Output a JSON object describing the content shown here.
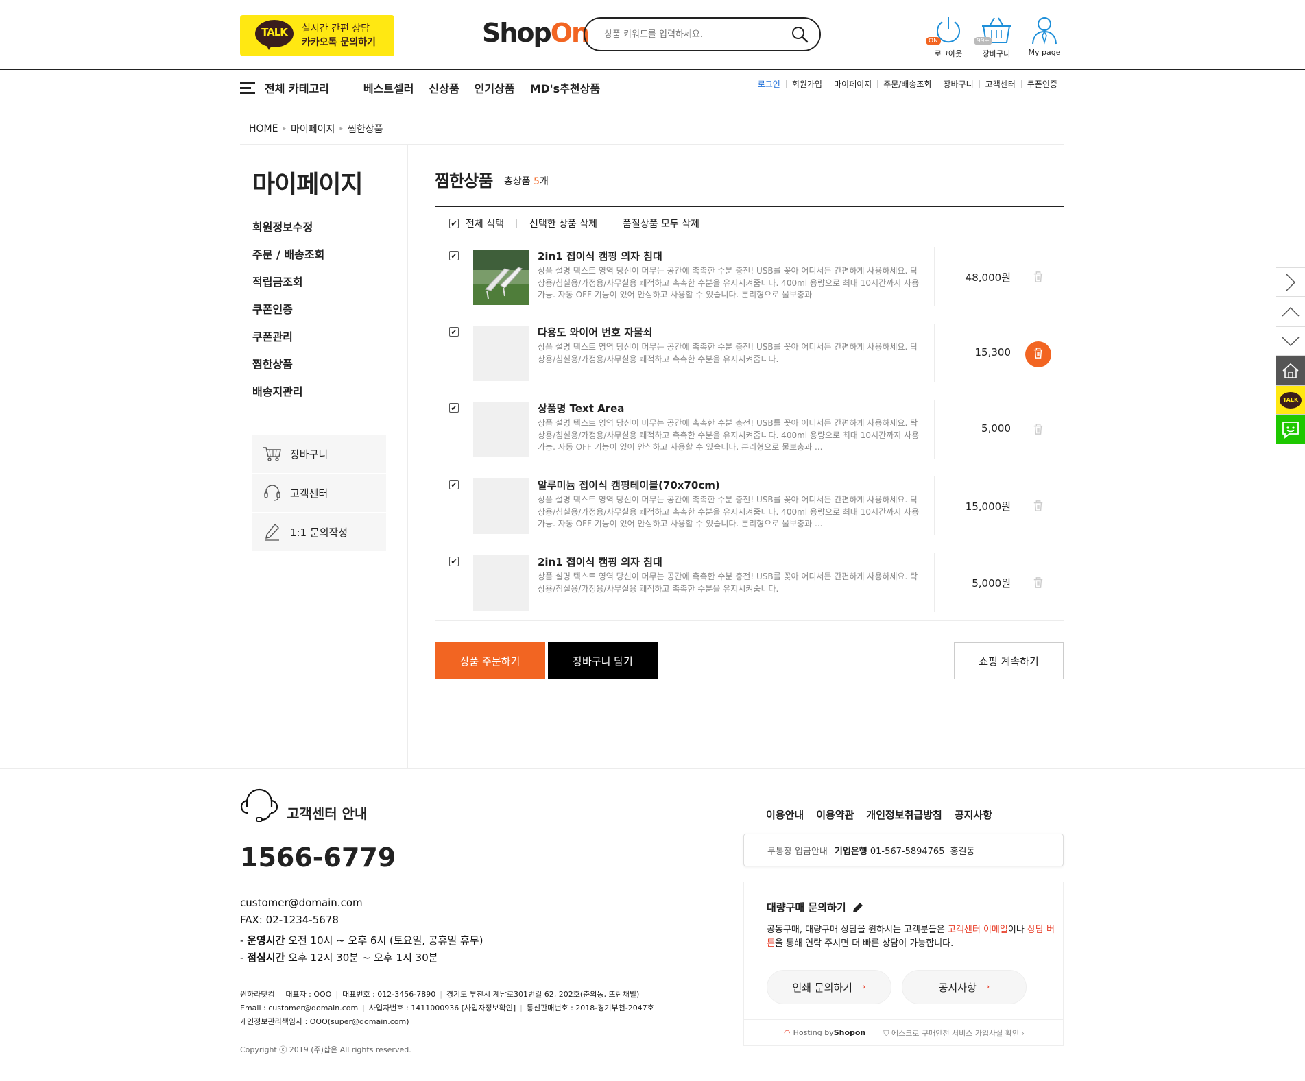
{
  "header": {
    "kakao": {
      "line1": "실시간 간편 상담",
      "line2": "카카오톡 문의하기",
      "icon_text": "TALK"
    },
    "logo": {
      "part1": "Shop",
      "part2": "On"
    },
    "search": {
      "placeholder": "상품 키워드를 입력하세요."
    },
    "icons": [
      {
        "name": "logout",
        "label": "로그아웃",
        "badge": "ON"
      },
      {
        "name": "cart",
        "label": "장바구니",
        "badge": "99+"
      },
      {
        "name": "mypage",
        "label": "My page"
      }
    ]
  },
  "nav": {
    "all_category": "전체 카테고리",
    "items": [
      "베스트셀러",
      "신상품",
      "인기상품",
      "MD's추천상품"
    ],
    "util": [
      "로그인",
      "회원가입",
      "마이페이지",
      "주문/배송조회",
      "장바구니",
      "고객센터",
      "쿠폰인증"
    ]
  },
  "breadcrumb": [
    "HOME",
    "마이페이지",
    "찜한상품"
  ],
  "sidebar": {
    "title": "마이페이지",
    "menu": [
      "회원정보수정",
      "주문 / 배송조회",
      "적립금조회",
      "쿠폰인증",
      "쿠폰관리",
      "찜한상품",
      "배송지관리"
    ],
    "boxes": [
      {
        "icon": "cart-icon",
        "label": "장바구니"
      },
      {
        "icon": "headset-icon",
        "label": "고객센터"
      },
      {
        "icon": "pencil-icon",
        "label": "1:1 문의작성"
      }
    ]
  },
  "content": {
    "title": "찜한상품",
    "total_prefix": "총상품",
    "total_count": "5",
    "total_suffix": "개",
    "toolbar": {
      "select_all": "전체 석택",
      "delete_selected": "선택한 상품 삭제",
      "delete_soldout": "품절상품 모두 삭제"
    },
    "products": [
      {
        "name": "2in1 접이식 캠핑 의자 침대",
        "desc": "상품 설명 텍스트 영역 당신이 머무는 공간에 촉촉한 수분 충전! USB를 꽂아 어디서든 간편하게 사용하세요. 탁상용/침실용/가정용/사무실용 쾌적하고 촉촉한 수분을 유지시켜줍니다. 400ml 용량으로 최대 10시간까지 사용가능. 자동 OFF 기능이 있어 안심하고 사용할 수 있습니다. 분리형으로 물보충과",
        "price": "48,000원",
        "checked": true,
        "has_image": true,
        "delete_active": false
      },
      {
        "name": "다용도 와이어 번호 자물쇠",
        "desc": "상품 설명 텍스트 영역 당신이 머무는 공간에 촉촉한 수분 충전! USB를 꽂아 어디서든 간편하게 사용하세요. 탁상용/침실용/가정용/사무실용 쾌적하고 촉촉한 수분을 유지시켜줍니다.",
        "price": "15,300",
        "checked": true,
        "has_image": false,
        "delete_active": true
      },
      {
        "name": "상품명 Text Area",
        "desc": "상품 설명 텍스트 영역 당신이 머무는 공간에 촉촉한 수분 충전! USB를 꽂아 어디서든 간편하게 사용하세요. 탁상용/침실용/가정용/사무실용 쾌적하고 촉촉한 수분을 유지시켜줍니다. 400ml 용량으로 최대 10시간까지 사용가능. 자동 OFF 기능이 있어 안심하고 사용할 수 있습니다. 분리형으로 물보충과 ...",
        "price": "5,000",
        "checked": true,
        "has_image": false,
        "delete_active": false
      },
      {
        "name": "알루미늄 접이식 캠핑테이블(70x70cm)",
        "desc": "상품 설명 텍스트 영역 당신이 머무는 공간에 촉촉한 수분 충전! USB를 꽂아 어디서든 간편하게 사용하세요. 탁상용/침실용/가정용/사무실용 쾌적하고 촉촉한 수분을 유지시켜줍니다. 400ml 용량으로 최대 10시간까지 사용가능. 자동 OFF 기능이 있어 안심하고 사용할 수 있습니다. 분리형으로 물보충과 ...",
        "price": "15,000원",
        "checked": true,
        "has_image": false,
        "delete_active": false
      },
      {
        "name": "2in1 접이식 캠핑 의자 침대",
        "desc": "상품 설명 텍스트 영역 당신이 머무는 공간에 촉촉한 수분 충전! USB를 꽂아 어디서든 간편하게 사용하세요. 탁상용/침실용/가정용/사무실용 쾌적하고 촉촉한 수분을 유지시켜줍니다.",
        "price": "5,000원",
        "checked": true,
        "has_image": false,
        "delete_active": false
      }
    ],
    "buttons": {
      "order": "상품 주문하기",
      "cart": "장바구니 담기",
      "continue": "쇼핑 계속하기"
    }
  },
  "quick_menu": [
    "chevron-right-icon",
    "chevron-up-icon",
    "chevron-down-icon",
    "home-icon",
    "kakao-talk-icon",
    "chat-icon"
  ],
  "quick_talk_text": "TALK",
  "footer": {
    "cs_title": "고객센터 안내",
    "phone": "1566-6779",
    "email": "customer@domain.com",
    "fax": "FAX: 02-1234-5678",
    "hours_label": "운영시간",
    "hours": "오전 10시 ~ 오후 6시 (토요일, 공휴일 휴무)",
    "lunch_label": "점심시간",
    "lunch": "오후 12시 30분 ~ 오후 1시 30분",
    "corp_line1": [
      "원하라닷컴",
      "대표자 : OOO",
      "대표번호 : 012-3456-7890",
      "경기도 부천시 계남로301번길 62, 202호(춘의동, 뜨란채빌)"
    ],
    "corp_line2": [
      "Email : customer@domain.com",
      "사업자번호 : 1411000936 [사업자정보확인]",
      "통신판매번호 : 2018-경기부천-2047호"
    ],
    "corp_line3": "개인정보관리책임자 : OOO(super@domain.com)",
    "copyright": "Copyright ⓒ 2019 (주)샵온 All rights reserved.",
    "links": [
      "이용안내",
      "이용약관",
      "개인정보취급방침",
      "공지사항"
    ],
    "bank": {
      "label": "무통장 입금안내",
      "bank_name": "기업은행",
      "account": "01-567-5894765",
      "holder": "홍길동"
    },
    "bulk": {
      "title": "대량구매 문의하기",
      "desc_a": "공동구매, 대량구매 상담을 원하시는 고객분들은 ",
      "link1": "고객센터 이메일",
      "desc_b": "이나 ",
      "link2": "상담 버튼",
      "desc_c": "을 통해 연락 주시면 더 빠른 상담이 가능합니다.",
      "btn1": "인쇄 문의하기",
      "btn2": "공지사항"
    },
    "hosting": {
      "prefix": "Hosting by ",
      "brand": "Shopon",
      "escrow": "에스크로 구매안전 서비스 가입사실 확인"
    }
  },
  "colors": {
    "accent": "#F26522",
    "kakao": "#FFE812",
    "link_blue": "#1e6fd9"
  }
}
